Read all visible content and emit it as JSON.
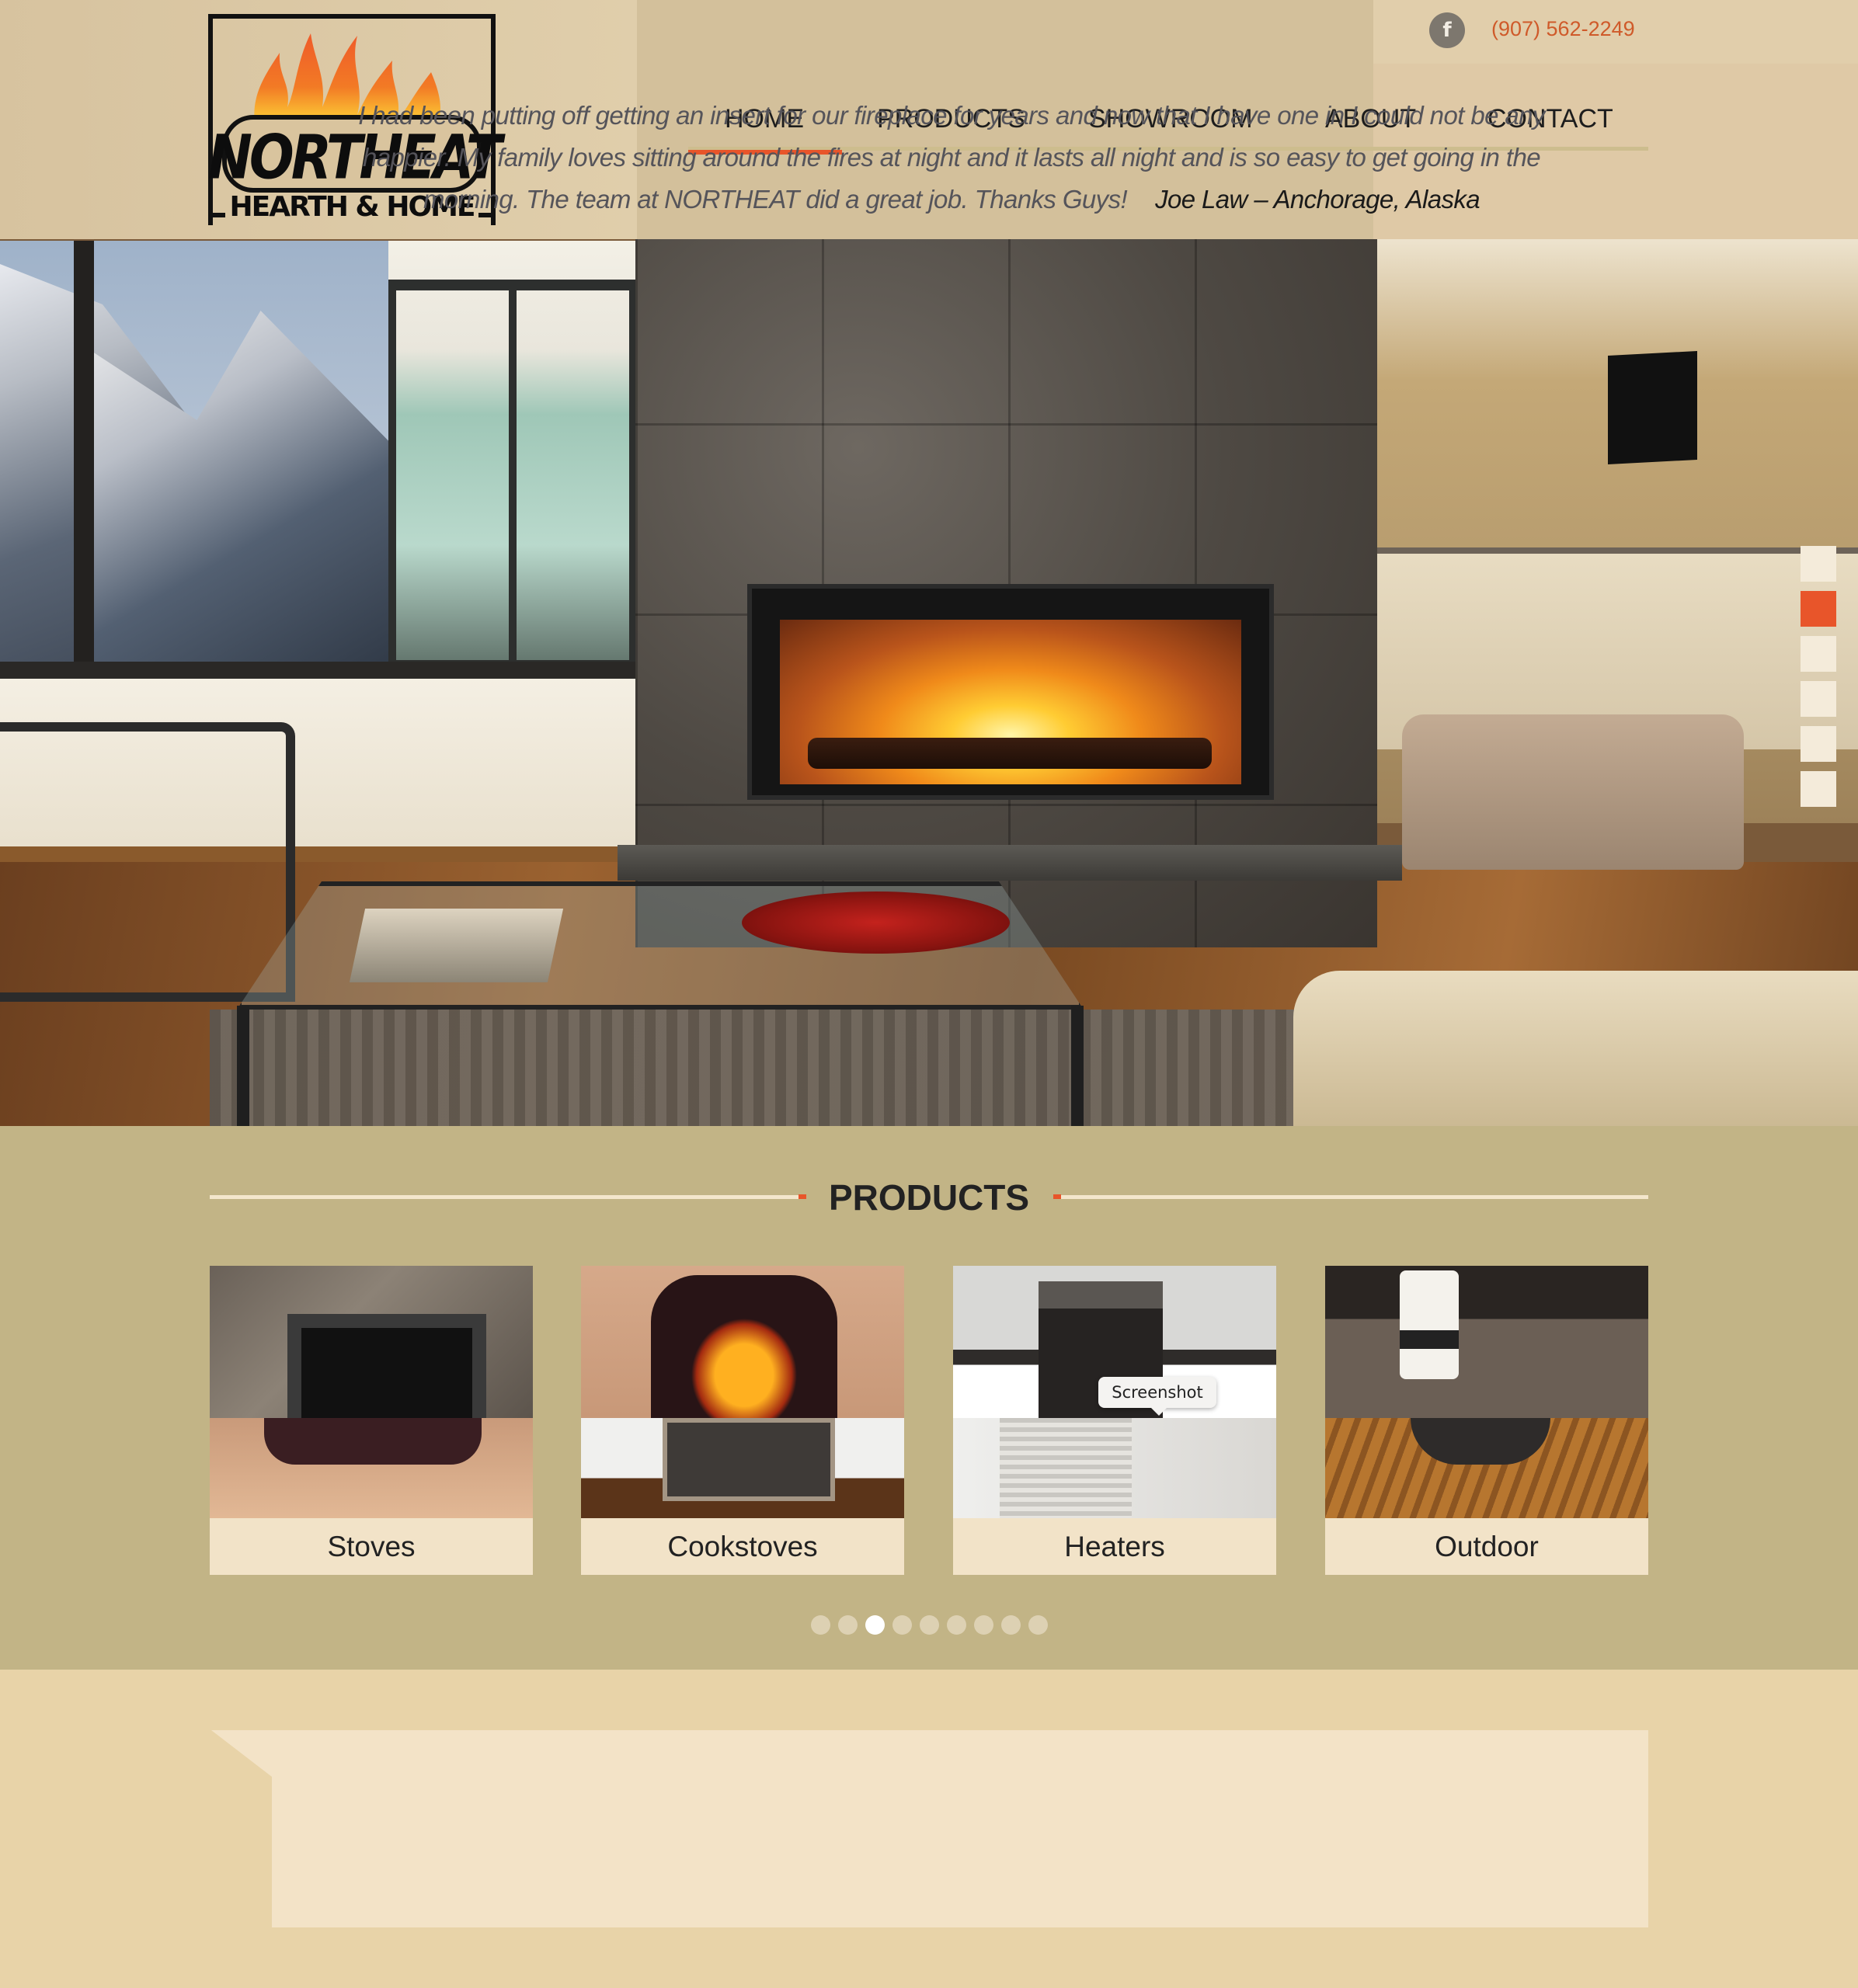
{
  "brand": {
    "name": "NORTHEAT",
    "tagline": "HEARTH & HOME"
  },
  "header": {
    "social_icon": "facebook-icon",
    "social_glyph": "f",
    "phone": "(907) 562-2249",
    "accent_color": "#e8552a"
  },
  "nav": {
    "items": [
      {
        "label": "HOME",
        "active": true
      },
      {
        "label": "PRODUCTS",
        "active": false
      },
      {
        "label": "SHOWROOM",
        "active": false
      },
      {
        "label": "ABOUT",
        "active": false
      },
      {
        "label": "CONTACT",
        "active": false
      }
    ]
  },
  "hero": {
    "slide_count": 6,
    "active_slide": 2
  },
  "products": {
    "title": "PRODUCTS",
    "cards": [
      {
        "label": "Stoves"
      },
      {
        "label": "Cookstoves"
      },
      {
        "label": "Heaters"
      },
      {
        "label": "Outdoor"
      }
    ],
    "pager": {
      "count": 9,
      "active": 3
    }
  },
  "tooltip": {
    "text": "Screenshot"
  },
  "testimonial": {
    "quote": "I had been putting off getting an insert for our fireplace for years and now that I have one in I could not be any happier.  My family loves sitting around the fires at night and it lasts all night and is so easy to get going in the morning.  The team at NORTHEAT did a great job.  Thanks Guys!",
    "author": "Joe Law – Anchorage, Alaska"
  }
}
